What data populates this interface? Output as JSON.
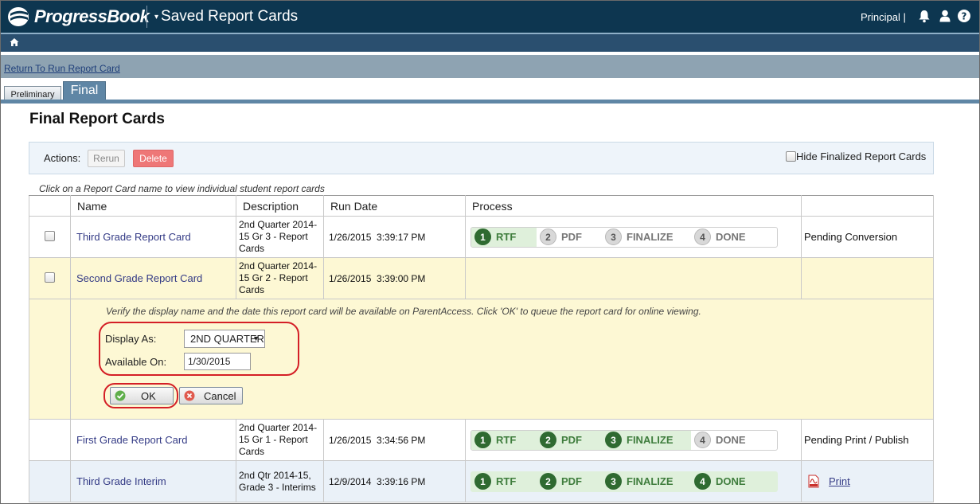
{
  "header": {
    "logo_text": "ProgressBook",
    "app_title": "Saved Report Cards",
    "title_caret": "▾",
    "user_role": "Principal |"
  },
  "sub_nav": {
    "return_link": "Return To Run Report Card"
  },
  "tabs": [
    {
      "label": "Preliminary",
      "active": false
    },
    {
      "label": "Final",
      "active": true
    }
  ],
  "page_title": "Final Report Cards",
  "actions": {
    "label": "Actions:",
    "rerun_label": "Rerun",
    "delete_label": "Delete",
    "hide_finalized_label": "Hide Finalized Report Cards"
  },
  "hint": "Click on a Report Card name to view individual student report cards",
  "table": {
    "headers": [
      "",
      "Name",
      "Description",
      "Run Date",
      "Process",
      ""
    ],
    "rows": [
      {
        "name": "Third Grade Report Card",
        "description": "2nd Quarter 2014-15 Gr 3 - Report Cards",
        "run_date": "1/26/2015  3:39:17 PM",
        "status": "Pending Conversion"
      },
      {
        "name": "Second Grade Report Card",
        "description": "2nd Quarter 2014-15 Gr 2 - Report Cards",
        "run_date": "1/26/2015  3:39:00 PM",
        "status": ""
      },
      {
        "name": "First Grade Report Card",
        "description": "2nd Quarter 2014-15 Gr 1 - Report Cards",
        "run_date": "1/26/2015  3:34:56 PM",
        "status": "Pending Print / Publish"
      },
      {
        "name": "Third Grade Interim",
        "description": "2nd Qtr 2014-15, Grade 3 - Interims",
        "run_date": "12/9/2014  3:39:16 PM",
        "status": "Print"
      }
    ]
  },
  "process_steps": [
    {
      "num": "1",
      "label": "RTF"
    },
    {
      "num": "2",
      "label": "PDF"
    },
    {
      "num": "3",
      "label": "FINALIZE"
    },
    {
      "num": "4",
      "label": "DONE"
    }
  ],
  "verify": {
    "text": "Verify the display name and the date this report card will be available on ParentAccess. Click 'OK' to queue the report card for online viewing.",
    "display_as_label": "Display As:",
    "display_as_value": "2ND QUARTER",
    "available_on_label": "Available On:",
    "available_on_value": "1/30/2015",
    "ok_label": "OK",
    "cancel_label": "Cancel"
  },
  "colors": {
    "header_bg": "#0d3650",
    "step_done": "#2f6a31",
    "highlight_ring": "#d41f26",
    "delete_button": "#ee7777"
  }
}
